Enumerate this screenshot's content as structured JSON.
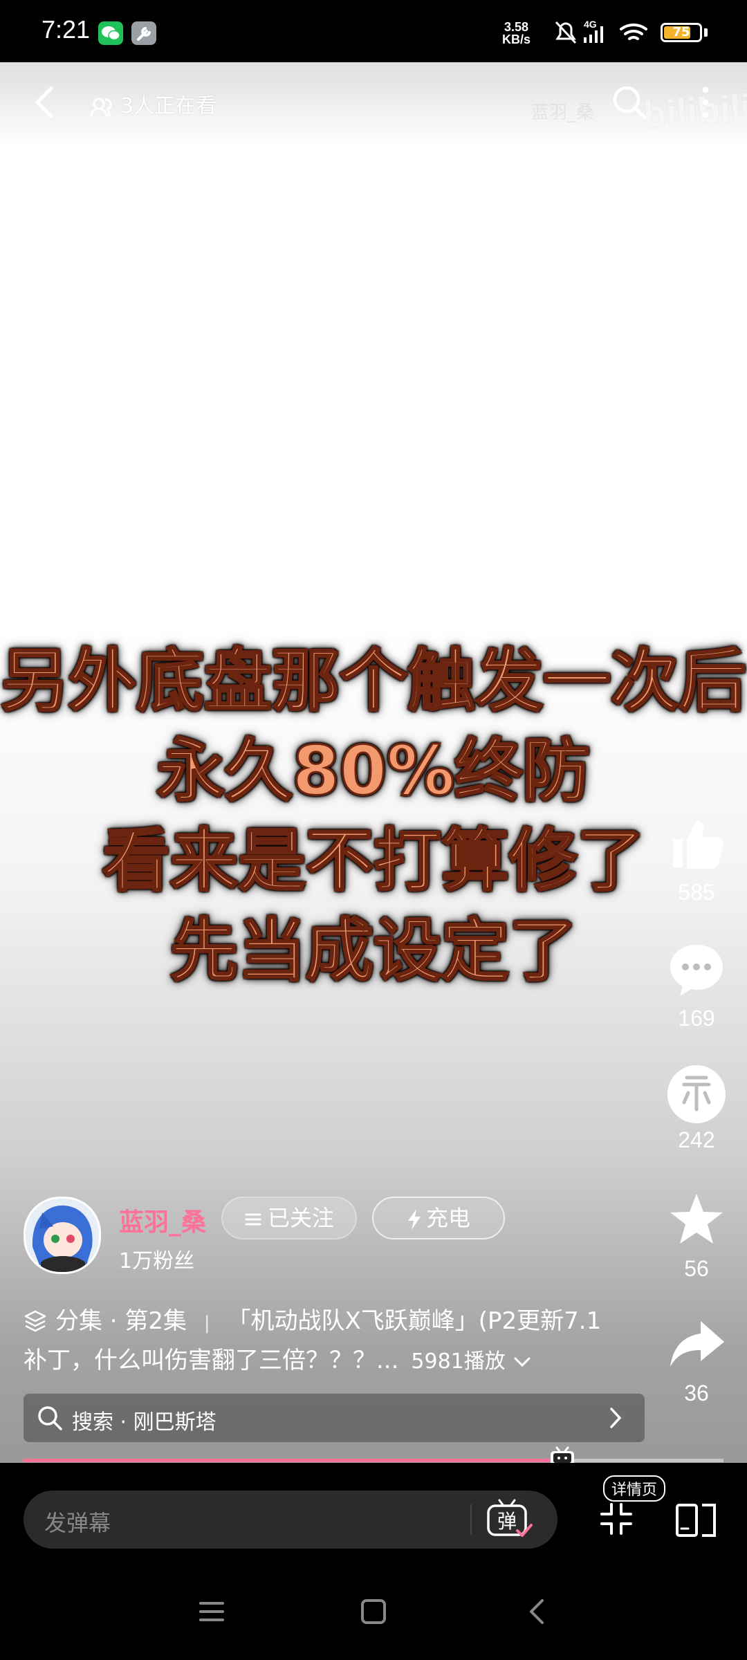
{
  "status_bar": {
    "time": "7:21",
    "net_speed_value": "3.58",
    "net_speed_unit": "KB/s",
    "network_type": "4G",
    "battery_level": "75",
    "battery_fraction": 0.75
  },
  "top_bar": {
    "watching": "3人正在看",
    "watermark_text": "bilibili",
    "watermark_user": "蓝羽_桑"
  },
  "caption": {
    "line1": "另外底盘那个触发一次后",
    "line2": "永久80%终防",
    "line3": "看来是不打算修了",
    "line4": "先当成设定了"
  },
  "actions": {
    "like_count": "585",
    "comment_count": "169",
    "coin_count": "242",
    "favorite_count": "56",
    "share_count": "36"
  },
  "uploader": {
    "name": "蓝羽_桑",
    "fans": "1万粉丝",
    "follow_label": "已关注",
    "charge_label": "充电"
  },
  "description": {
    "episode": "分集 · 第2集",
    "separator": "|",
    "title_line1": "「机动战队X飞跃巅峰」(P2更新7.1",
    "title_line2": "补丁，什么叫伤害翻了三倍？？？...",
    "plays": "5981播放"
  },
  "search": {
    "text": "搜索 · 刚巴斯塔"
  },
  "player": {
    "progress": 0.77,
    "danmaku_placeholder": "发弹幕",
    "danmaku_toggle_label": "弹",
    "detail_label": "详情页"
  },
  "colors": {
    "accent_pink": "#fb7299",
    "caption_fill": "#f29a6e",
    "battery_fill": "#f4b32b",
    "wechat_green": "#1fc25a"
  }
}
